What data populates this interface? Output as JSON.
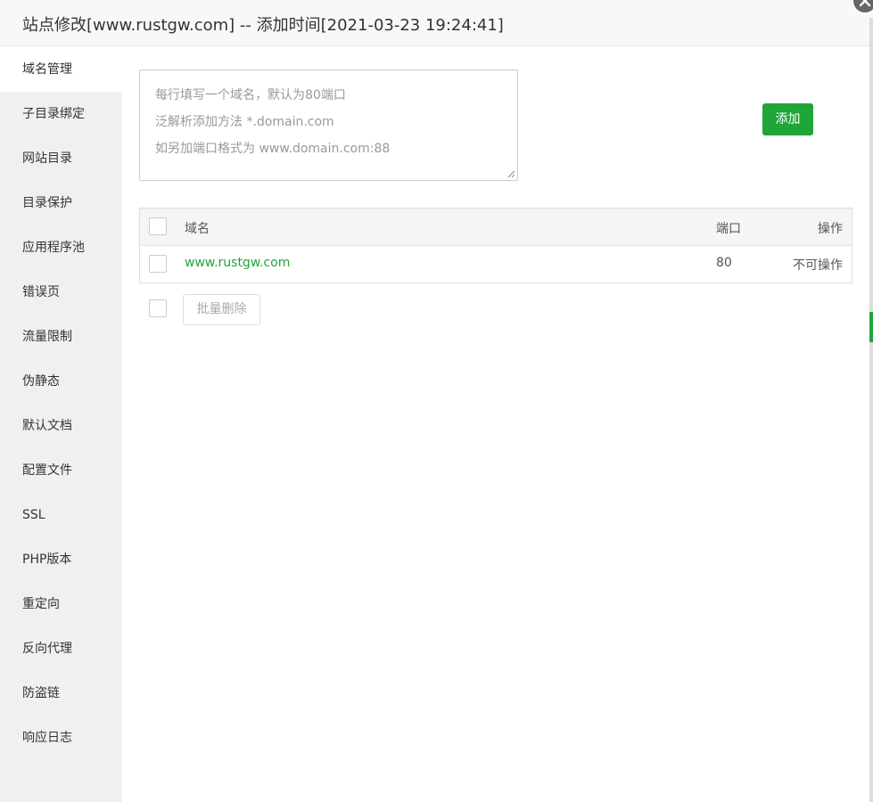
{
  "dialog": {
    "title": "站点修改[www.rustgw.com] -- 添加时间[2021-03-23 19:24:41]"
  },
  "sidebar": {
    "items": [
      {
        "label": "域名管理"
      },
      {
        "label": "子目录绑定"
      },
      {
        "label": "网站目录"
      },
      {
        "label": "目录保护"
      },
      {
        "label": "应用程序池"
      },
      {
        "label": "错误页"
      },
      {
        "label": "流量限制"
      },
      {
        "label": "伪静态"
      },
      {
        "label": "默认文档"
      },
      {
        "label": "配置文件"
      },
      {
        "label": "SSL"
      },
      {
        "label": "PHP版本"
      },
      {
        "label": "重定向"
      },
      {
        "label": "反向代理"
      },
      {
        "label": "防盗链"
      },
      {
        "label": "响应日志"
      }
    ],
    "active_index": 0
  },
  "domain_input": {
    "placeholder_lines": [
      "每行填写一个域名，默认为80端口",
      "泛解析添加方法 *.domain.com",
      "如另加端口格式为 www.domain.com:88"
    ],
    "value": ""
  },
  "add_button": {
    "label": "添加"
  },
  "table": {
    "headers": {
      "domain": "域名",
      "port": "端口",
      "action": "操作"
    },
    "rows": [
      {
        "domain": "www.rustgw.com",
        "port": "80",
        "action": "不可操作"
      }
    ]
  },
  "batch_delete_button": {
    "label": "批量删除"
  },
  "colors": {
    "accent": "#20a53a",
    "sidebar_bg": "#f0f0f0",
    "header_bg": "#f8f8f8"
  },
  "icons": {
    "close": "close-icon",
    "resize": "resize-grip-icon"
  }
}
